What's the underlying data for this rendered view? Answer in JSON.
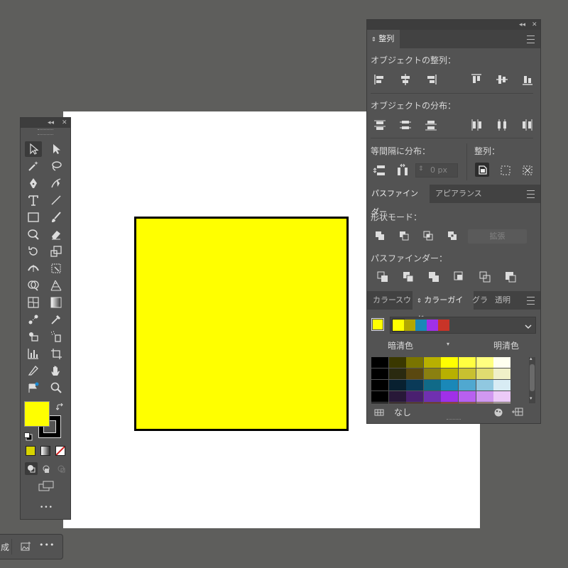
{
  "canvas": {
    "shape_fill": "#ffff00",
    "shape_stroke": "#000000",
    "artboard_color": "#ffffff"
  },
  "toolbox": {
    "collapse_glyph": "◂◂",
    "close_glyph": "✕",
    "more_glyph": "•••",
    "fill_color": "#ffff00",
    "stroke_color": "#000000"
  },
  "align_panel": {
    "tab": "整列",
    "object_align_label": "オブジェクトの整列：",
    "object_distribute_label": "オブジェクトの分布：",
    "spacing_label": "等間隔に分布：",
    "align_to_label": "整列：",
    "spacing_value": "0 px"
  },
  "pathfinder_panel": {
    "tabs": [
      "パスファインダー",
      "アピアランス"
    ],
    "shape_mode_label": "形状モード：",
    "expand_button": "拡張",
    "pathfinder_label": "パスファインダー："
  },
  "color_guide_panel": {
    "tabs": [
      "カラー",
      "スウォ",
      "カラーガイド",
      "グラ",
      "透明"
    ],
    "shades_label": "暗清色",
    "tints_label": "明清色",
    "footer_none_label": "なし",
    "harmony_colors": [
      "#ffff00",
      "#b2a800",
      "#1a88b8",
      "#a030e8",
      "#c83428"
    ],
    "grid": [
      [
        "#000000",
        "#3a3800",
        "#7a7400",
        "#b8b000",
        "#ffff00",
        "#ffff40",
        "#ffff80",
        "#fffff0"
      ],
      [
        "#000000",
        "#2a2a10",
        "#5a4810",
        "#8a8010",
        "#b8b000",
        "#c8c030",
        "#e0dc70",
        "#f0f0c8"
      ],
      [
        "#000000",
        "#082030",
        "#0a3a58",
        "#106a88",
        "#1a88b8",
        "#50a8d0",
        "#90c8e0",
        "#d8ecf4"
      ],
      [
        "#000000",
        "#281838",
        "#4a2070",
        "#7030b0",
        "#a030e8",
        "#b860f0",
        "#d098f0",
        "#eccaf8"
      ],
      [
        "#000000",
        "#200808",
        "#502010",
        "#882818",
        "#c83428",
        "#d06050",
        "#e0a090",
        "#f4e0d8"
      ]
    ]
  },
  "bottom_bar": {
    "partial_label": "成",
    "more_glyph": "•••"
  }
}
